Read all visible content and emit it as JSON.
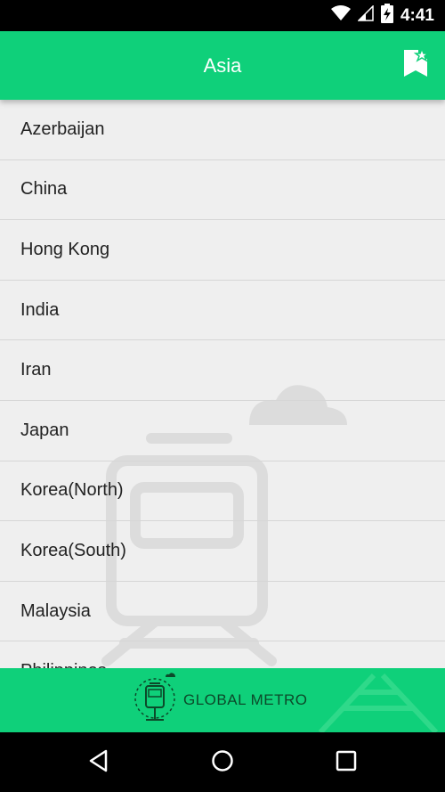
{
  "status_bar": {
    "time": "4:41",
    "icons": [
      "wifi-icon",
      "cellular-signal-icon",
      "battery-charging-icon"
    ]
  },
  "app_bar": {
    "title": "Asia",
    "favorites_icon": "bookmark-star-icon"
  },
  "countries": [
    "Azerbaijan",
    "China",
    "Hong Kong",
    "India",
    "Iran",
    "Japan",
    "Korea(North)",
    "Korea(South)",
    "Malaysia",
    "Philippines"
  ],
  "banner": {
    "label": "GLOBAL METRO",
    "icon": "metro-train-icon"
  },
  "nav_bar": {
    "back": "back-icon",
    "home": "home-icon",
    "recents": "recents-icon"
  },
  "colors": {
    "accent": "#0fd07a",
    "banner_text": "#0c4a2a",
    "background": "#efefef"
  }
}
